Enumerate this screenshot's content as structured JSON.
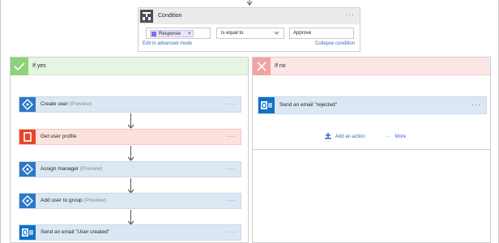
{
  "condition": {
    "title": "Condition",
    "menu": "···",
    "token_label": "Response",
    "token_remove": "×",
    "operator": "is equal to",
    "value": "Approve",
    "edit_advanced": "Edit in advanced mode",
    "collapse": "Collapse condition"
  },
  "yes_branch": {
    "title": "If yes",
    "actions": [
      {
        "label": "Create user",
        "suffix": "(Preview)",
        "menu": "···",
        "icon": "connector-icon"
      },
      {
        "label": "Get user profile",
        "suffix": "",
        "menu": "···",
        "icon": "office365-icon"
      },
      {
        "label": "Assign manager",
        "suffix": "(Preview)",
        "menu": "···",
        "icon": "connector-icon"
      },
      {
        "label": "Add user to group",
        "suffix": "(Preview)",
        "menu": "···",
        "icon": "connector-icon"
      },
      {
        "label": "Send an email \"User created\"",
        "suffix": "",
        "menu": "···",
        "icon": "outlook-icon"
      }
    ]
  },
  "no_branch": {
    "title": "If no",
    "action": {
      "label": "Send an email \"rejected\"",
      "menu": "···",
      "icon": "outlook-icon"
    },
    "add_action": "Add an action",
    "more_label": "More",
    "more_dots": "···"
  },
  "colors": {
    "yes_accent": "#8fd27b",
    "no_accent": "#f4a3a3",
    "card_blue": "#dbe8f4",
    "card_red": "#fbe2dd",
    "link": "#2f6fb8"
  }
}
